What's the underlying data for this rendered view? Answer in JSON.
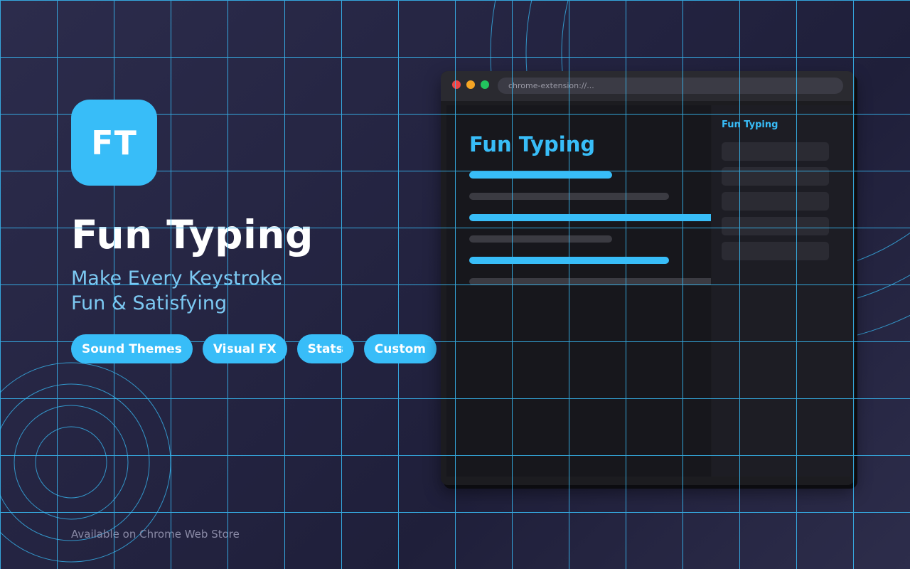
{
  "logo": {
    "text": "FT"
  },
  "app": {
    "title": "Fun Typing",
    "tagline": [
      "Make Every Keystroke",
      "Fun & Satisfying"
    ]
  },
  "features": [
    "Sound Themes",
    "Visual FX",
    "Stats",
    "Custom"
  ],
  "store_text": "Available on Chrome Web Store",
  "browser": {
    "url": "chrome-extension://...",
    "preview_title": "Fun Typing",
    "sidebar_title": "Fun Typing",
    "sidebar_rows": 5
  },
  "colors": {
    "accent": "#38bdf8",
    "background": "#23233f",
    "grid": "#38bdf8",
    "window_red": "#ef4444",
    "window_yellow": "#f5a524",
    "window_green": "#22c55e"
  }
}
